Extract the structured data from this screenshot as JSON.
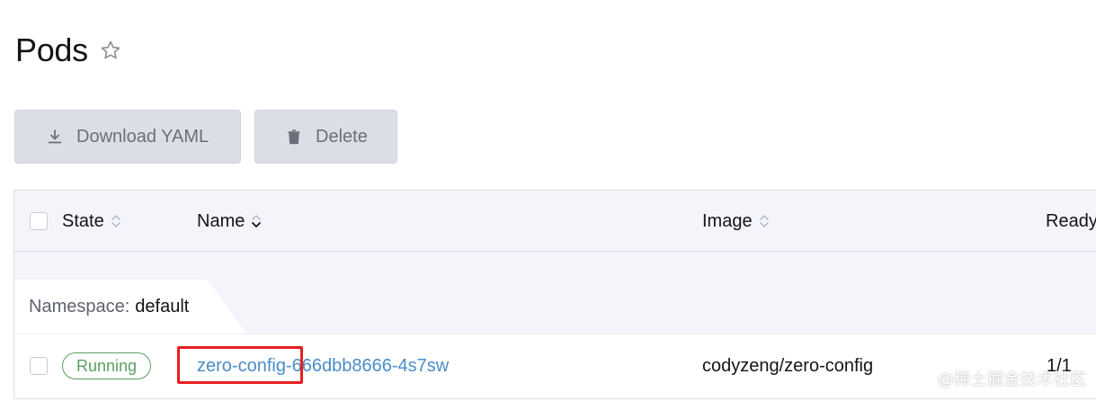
{
  "header": {
    "title": "Pods"
  },
  "toolbar": {
    "download_label": "Download YAML",
    "delete_label": "Delete"
  },
  "table": {
    "columns": [
      "State",
      "Name",
      "Image",
      "Ready"
    ],
    "group": {
      "label": "Namespace:",
      "value": "default"
    },
    "rows": [
      {
        "state": "Running",
        "name": "zero-config-666dbb8666-4s7sw",
        "image": "codyzeng/zero-config",
        "ready": "1/1"
      }
    ]
  },
  "watermark": "@稀土掘金技术社区",
  "colors": {
    "running": "#5d9e62",
    "link": "#4b8cc7",
    "highlight": "#e51f1f",
    "button_bg": "#dcdee7"
  },
  "icons": {
    "favorite": "star-outline-icon",
    "download": "download-icon",
    "delete": "trash-icon",
    "sort": "sort-icon"
  }
}
